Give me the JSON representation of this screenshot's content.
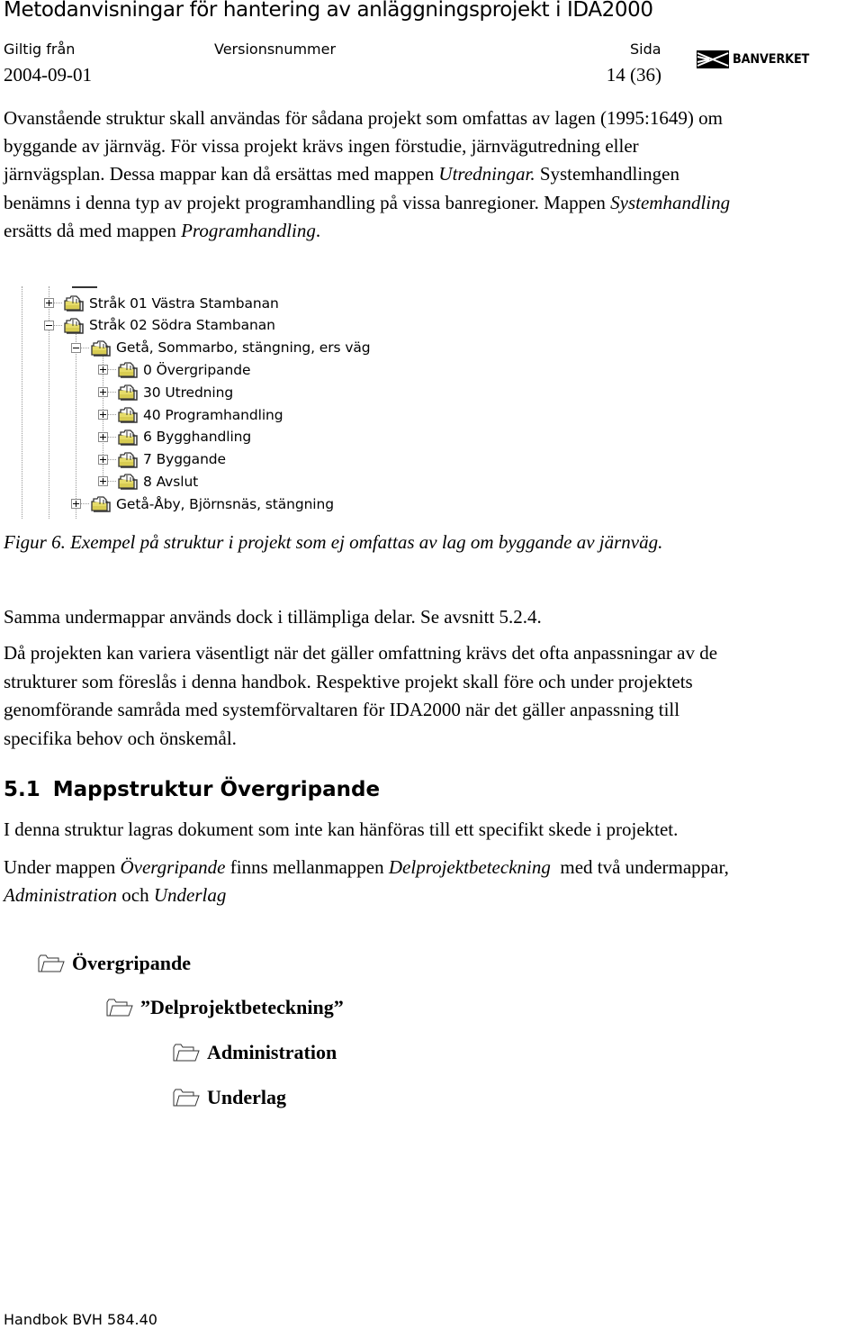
{
  "header": {
    "title": "Metodanvisningar för hantering av anläggningsprojekt i IDA2000",
    "valid_from_label": "Giltig från",
    "version_label": "Versionsnummer",
    "page_label": "Sida",
    "valid_from_value": "2004-09-01",
    "version_value": "",
    "page_value": "14 (36)",
    "logo_text": "BANVERKET"
  },
  "paragraphs": {
    "p1": [
      {
        "t": "Ovanstående struktur skall användas för sådana projekt som omfattas av lagen (1995:1649) om"
      },
      {
        "t": "byggande av järnväg. För vissa projekt krävs ingen förstudie, järnvägutredning eller"
      },
      {
        "t": "järnvägsplan. Dessa mappar kan då ersättas med mappen ",
        "i": "Utredningar.",
        "t2": " Systemhandlingen"
      },
      {
        "t": "benämns i denna typ av projekt programhandling på vissa banregioner. Mappen ",
        "i": "Systemhandling"
      },
      {
        "t": "ersätts då med mappen ",
        "i": "Programhandling",
        "t2": "."
      }
    ],
    "caption": "Figur 6. Exempel på struktur i projekt som ej omfattas av lag om byggande av järnväg.",
    "p2": "Samma undermappar används dock i tillämpliga delar. Se avsnitt 5.2.4.",
    "p3": [
      "Då projekten kan variera väsentligt när det gäller omfattning krävs det ofta anpassningar av de",
      "strukturer som föreslås i denna handbok. Respektive projekt skall före och under projektets",
      "genomförande samråda med systemförvaltaren för IDA2000 när det gäller anpassning till",
      "specifika behov och önskemål."
    ],
    "p4": "I denna struktur lagras dokument som inte kan hänföras till ett specifikt skede i projektet.",
    "p5": {
      "line1_a": "Under mappen ",
      "line1_i1": "Övergripande",
      "line1_b": " finns mellanmappen ",
      "line1_i2": "Delprojektbeteckning",
      "line1_c": "  med två undermappar,",
      "line2_i1": "Administration",
      "line2_b": " och ",
      "line2_i2": "Underlag"
    }
  },
  "section": {
    "number": "5.1",
    "title": "Mappstruktur Övergripande"
  },
  "tree": {
    "items": [
      {
        "label": "Stråk 01 Västra Stambanan",
        "level": 0,
        "state": "collapsed",
        "icon": "folder-icon"
      },
      {
        "label": "Stråk 02 Södra Stambanan",
        "level": 0,
        "state": "expanded",
        "icon": "folder-icon"
      },
      {
        "label": "Getå, Sommarbo, stängning, ers väg",
        "level": 1,
        "state": "expanded",
        "icon": "folder-icon"
      },
      {
        "label": "0 Övergripande",
        "level": 2,
        "state": "collapsed",
        "icon": "folder-icon"
      },
      {
        "label": "30 Utredning",
        "level": 2,
        "state": "collapsed",
        "icon": "folder-icon"
      },
      {
        "label": "40 Programhandling",
        "level": 2,
        "state": "collapsed",
        "icon": "folder-icon"
      },
      {
        "label": "6 Bygghandling",
        "level": 2,
        "state": "collapsed",
        "icon": "folder-icon"
      },
      {
        "label": "7 Byggande",
        "level": 2,
        "state": "collapsed",
        "icon": "folder-icon"
      },
      {
        "label": "8 Avslut",
        "level": 2,
        "state": "collapsed",
        "icon": "folder-icon"
      },
      {
        "label": "Getå-Åby, Björnsnäs, stängning",
        "level": 1,
        "state": "collapsed",
        "icon": "folder-icon"
      }
    ]
  },
  "folder_list": [
    {
      "label": "Övergripande",
      "icon": "folder-outline-icon"
    },
    {
      "label": "”Delprojektbeteckning”",
      "icon": "folder-outline-icon"
    },
    {
      "label": "Administration",
      "icon": "folder-outline-icon"
    },
    {
      "label": "Underlag",
      "icon": "folder-outline-icon"
    }
  ],
  "footer": {
    "text": "Handbok BVH 584.40"
  }
}
